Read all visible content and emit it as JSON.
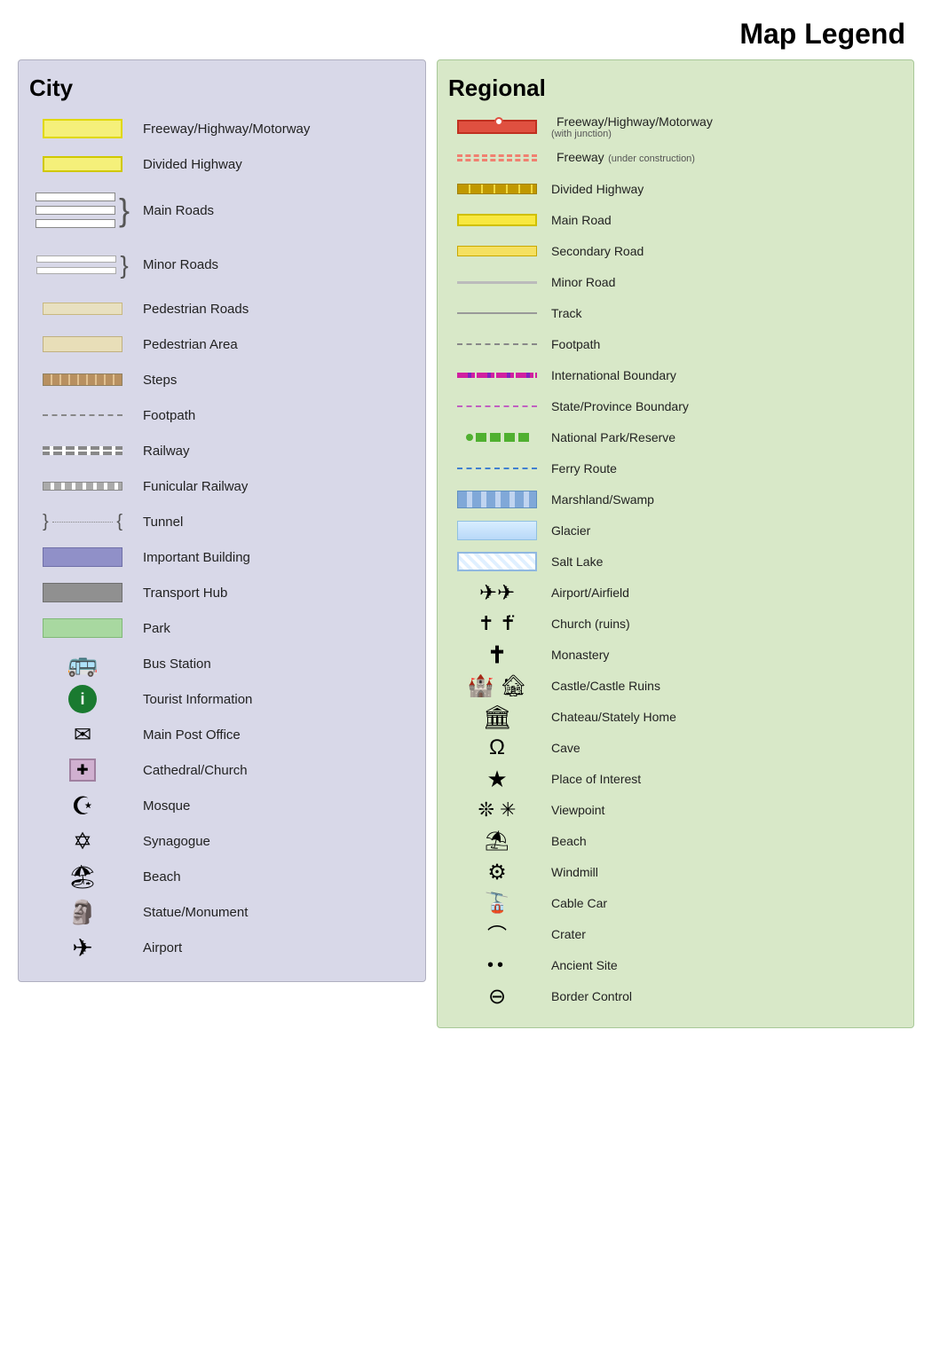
{
  "page": {
    "title": "Map Legend"
  },
  "city": {
    "title": "City",
    "items": [
      {
        "id": "freeway",
        "label": "Freeway/Highway/Motorway"
      },
      {
        "id": "divided-highway",
        "label": "Divided Highway"
      },
      {
        "id": "main-roads",
        "label": "Main Roads"
      },
      {
        "id": "minor-roads",
        "label": "Minor Roads"
      },
      {
        "id": "pedestrian-roads",
        "label": "Pedestrian Roads"
      },
      {
        "id": "pedestrian-area",
        "label": "Pedestrian Area"
      },
      {
        "id": "steps",
        "label": "Steps"
      },
      {
        "id": "footpath",
        "label": "Footpath"
      },
      {
        "id": "railway",
        "label": "Railway"
      },
      {
        "id": "funicular-railway",
        "label": "Funicular Railway"
      },
      {
        "id": "tunnel",
        "label": "Tunnel"
      },
      {
        "id": "important-building",
        "label": "Important Building"
      },
      {
        "id": "transport-hub",
        "label": "Transport Hub"
      },
      {
        "id": "park",
        "label": "Park"
      },
      {
        "id": "bus-station",
        "label": "Bus Station"
      },
      {
        "id": "tourist-info",
        "label": "Tourist Information"
      },
      {
        "id": "main-post-office",
        "label": "Main Post Office"
      },
      {
        "id": "cathedral-church",
        "label": "Cathedral/Church"
      },
      {
        "id": "mosque",
        "label": "Mosque"
      },
      {
        "id": "synagogue",
        "label": "Synagogue"
      },
      {
        "id": "beach",
        "label": "Beach"
      },
      {
        "id": "statue-monument",
        "label": "Statue/Monument"
      },
      {
        "id": "airport",
        "label": "Airport"
      }
    ]
  },
  "regional": {
    "title": "Regional",
    "items": [
      {
        "id": "reg-freeway",
        "label": "Freeway/Highway/Motorway",
        "sublabel": "(with junction)"
      },
      {
        "id": "reg-freeway-construction",
        "label": "Freeway",
        "sublabel": "(under construction)"
      },
      {
        "id": "reg-divided",
        "label": "Divided Highway"
      },
      {
        "id": "reg-main-road",
        "label": "Main Road"
      },
      {
        "id": "reg-secondary",
        "label": "Secondary Road"
      },
      {
        "id": "reg-minor",
        "label": "Minor Road"
      },
      {
        "id": "reg-track",
        "label": "Track"
      },
      {
        "id": "reg-footpath",
        "label": "Footpath"
      },
      {
        "id": "reg-intl-boundary",
        "label": "International Boundary"
      },
      {
        "id": "reg-state-boundary",
        "label": "State/Province Boundary"
      },
      {
        "id": "reg-national-park",
        "label": "National Park/Reserve"
      },
      {
        "id": "reg-ferry",
        "label": "Ferry Route"
      },
      {
        "id": "reg-marshland",
        "label": "Marshland/Swamp"
      },
      {
        "id": "reg-glacier",
        "label": "Glacier"
      },
      {
        "id": "reg-salt-lake",
        "label": "Salt Lake"
      },
      {
        "id": "reg-airport",
        "label": "Airport/Airfield"
      },
      {
        "id": "reg-church",
        "label": "Church (ruins)"
      },
      {
        "id": "reg-monastery",
        "label": "Monastery"
      },
      {
        "id": "reg-castle",
        "label": "Castle/Castle Ruins"
      },
      {
        "id": "reg-chateau",
        "label": "Chateau/Stately Home"
      },
      {
        "id": "reg-cave",
        "label": "Cave"
      },
      {
        "id": "reg-poi",
        "label": "Place of Interest"
      },
      {
        "id": "reg-viewpoint",
        "label": "Viewpoint"
      },
      {
        "id": "reg-beach",
        "label": "Beach"
      },
      {
        "id": "reg-windmill",
        "label": "Windmill"
      },
      {
        "id": "reg-cable-car",
        "label": "Cable Car"
      },
      {
        "id": "reg-crater",
        "label": "Crater"
      },
      {
        "id": "reg-ancient-site",
        "label": "Ancient Site"
      },
      {
        "id": "reg-border-control",
        "label": "Border Control"
      }
    ]
  }
}
